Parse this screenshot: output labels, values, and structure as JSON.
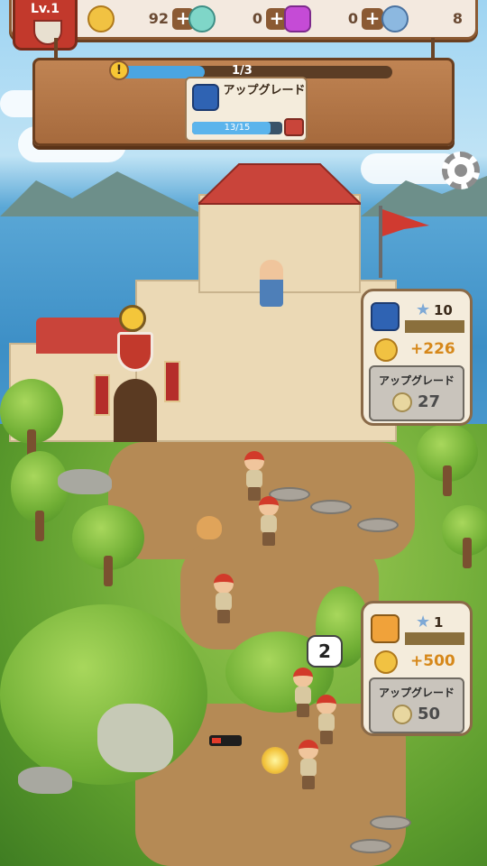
{
  "header": {
    "level": "Lv.1",
    "resources": [
      {
        "name": "coin",
        "value": "92",
        "icon": "coin-face-icon"
      },
      {
        "name": "potion",
        "value": "0",
        "icon": "potion-flask-icon"
      },
      {
        "name": "gem",
        "value": "0",
        "icon": "purple-gem-icon"
      },
      {
        "name": "exp",
        "value": "8",
        "icon": "exp-badge-icon"
      }
    ]
  },
  "quest": {
    "progress_text": "1/3",
    "progress": 0.33,
    "card": {
      "title": "アップグレード",
      "progress_text": "13/15",
      "progress": 0.87
    }
  },
  "panels": [
    {
      "stars": "10",
      "earn": "+226",
      "upgrade_label": "アップグレード",
      "cost": "27"
    },
    {
      "stars": "1",
      "earn": "+500",
      "upgrade_label": "アップグレード",
      "cost": "50"
    }
  ],
  "bubble_count": "2",
  "colors": {
    "wood": "#a66a3d",
    "accent_red": "#c2392c",
    "bar_blue": "#4aa5e2",
    "earn_orange": "#d6881a"
  }
}
